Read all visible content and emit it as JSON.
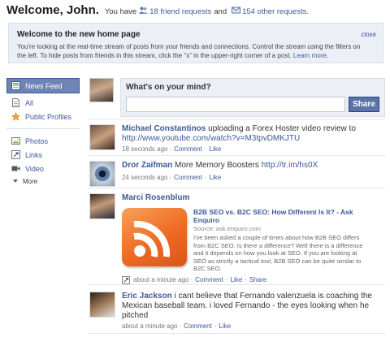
{
  "header": {
    "welcome": "Welcome, John.",
    "you_have": "You have",
    "friend_requests": "18 friend requests",
    "and": "and",
    "other_requests": "154 other requests."
  },
  "notice": {
    "title": "Welcome to the new home page",
    "body": "You're looking at the real-time stream of posts from your friends and connections. Control the stream using the filters on the left. To hide posts from friends in this stream, click the \"x\" in the upper-right corner of a post.",
    "learn_more": "Learn more.",
    "close": "close"
  },
  "sidebar": {
    "items": [
      {
        "label": "News Feed",
        "icon": "news-feed-icon"
      },
      {
        "label": "All",
        "icon": "page-icon"
      },
      {
        "label": "Public Profiles",
        "icon": "public-profiles-icon"
      },
      {
        "label": "Photos",
        "icon": "photos-icon"
      },
      {
        "label": "Links",
        "icon": "links-icon"
      },
      {
        "label": "Video",
        "icon": "video-icon"
      }
    ],
    "more": "More"
  },
  "composer": {
    "label": "What's on your mind?",
    "input_value": "",
    "share": "Share"
  },
  "stories": [
    {
      "actor": "Michael Constantinos",
      "text": " uploading a Forex Hoster video review to ",
      "link": "http://www.youtube.com/watch?v=M3tpvDMKJTU",
      "time": "18 seconds ago",
      "actions": [
        "Comment",
        "Like"
      ]
    },
    {
      "actor": "Dror Zaifman",
      "text": " More Memory Boosters ",
      "link": "http://tr.im/hs0X",
      "time": "24 seconds ago",
      "actions": [
        "Comment",
        "Like"
      ]
    },
    {
      "actor": "Marci Rosenblum",
      "attachment": {
        "title": "B2B SEO vs. B2C SEO: How Different Is It? - Ask Enquiro",
        "source": "Source: ask.enquiro.com",
        "description": "I've been asked a couple of times about how B2B SEO differs from B2C SEO.  Is there a difference?  Well there is a difference and it depends on how you look at SEO.  If you are looking at SEO as strictly a tactical tool, B2B SEO can be quite similar to B2C SEO."
      },
      "time": "about a minute ago",
      "actions": [
        "Comment",
        "Like",
        "Share"
      ]
    },
    {
      "actor": "Eric Jackson",
      "text": " i cant believe that Fernando valenzuela is coaching the Mexican baseball team. i loved Fernando - the eyes looking when he pitched",
      "time": "about a minute ago",
      "actions": [
        "Comment",
        "Like"
      ]
    }
  ],
  "colors": {
    "brand_blue": "#3b5998",
    "selected_nav": "#6d84b4",
    "notice_bg": "#eceff5",
    "rss_orange": "#ef6a22"
  }
}
